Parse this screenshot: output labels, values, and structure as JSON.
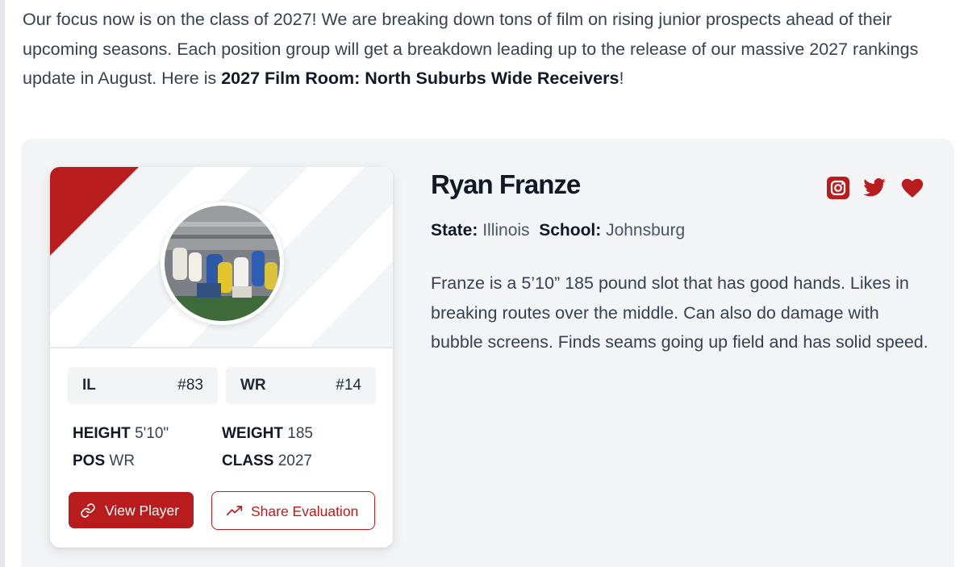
{
  "intro": {
    "text_before": "Our focus now is on the class of 2027!  We are breaking down tons of film on rising junior prospects ahead of their upcoming seasons.  Each position group will get a breakdown leading up to the release of our massive 2027 rankings update in August.  Here is ",
    "bold_title": "2027 Film Room: North Suburbs Wide Receivers",
    "text_after": "!"
  },
  "player": {
    "name": "Ryan Franze",
    "state_label": "State:",
    "state": "Illinois",
    "school_label": "School:",
    "school": "Johnsburg",
    "bio": "Franze is a 5’10” 185 pound slot that has good hands. Likes in breaking routes over the middle.  Can also do damage with bubble screens.  Finds seams going up field and has solid speed."
  },
  "rankings": [
    {
      "label": "IL",
      "rank": "#83"
    },
    {
      "label": "WR",
      "rank": "#14"
    }
  ],
  "stats": {
    "height_label": "HEIGHT",
    "height": "5'10\"",
    "weight_label": "WEIGHT",
    "weight": "185",
    "pos_label": "POS",
    "pos": "WR",
    "class_label": "CLASS",
    "class": "2027"
  },
  "buttons": {
    "view_player": "View Player",
    "share_evaluation": "Share Evaluation"
  },
  "social_icons": [
    "instagram-icon",
    "twitter-icon",
    "heart-icon"
  ],
  "colors": {
    "accent": "#b91c1c",
    "panel": "#f3f4f6",
    "text": "#374151"
  }
}
